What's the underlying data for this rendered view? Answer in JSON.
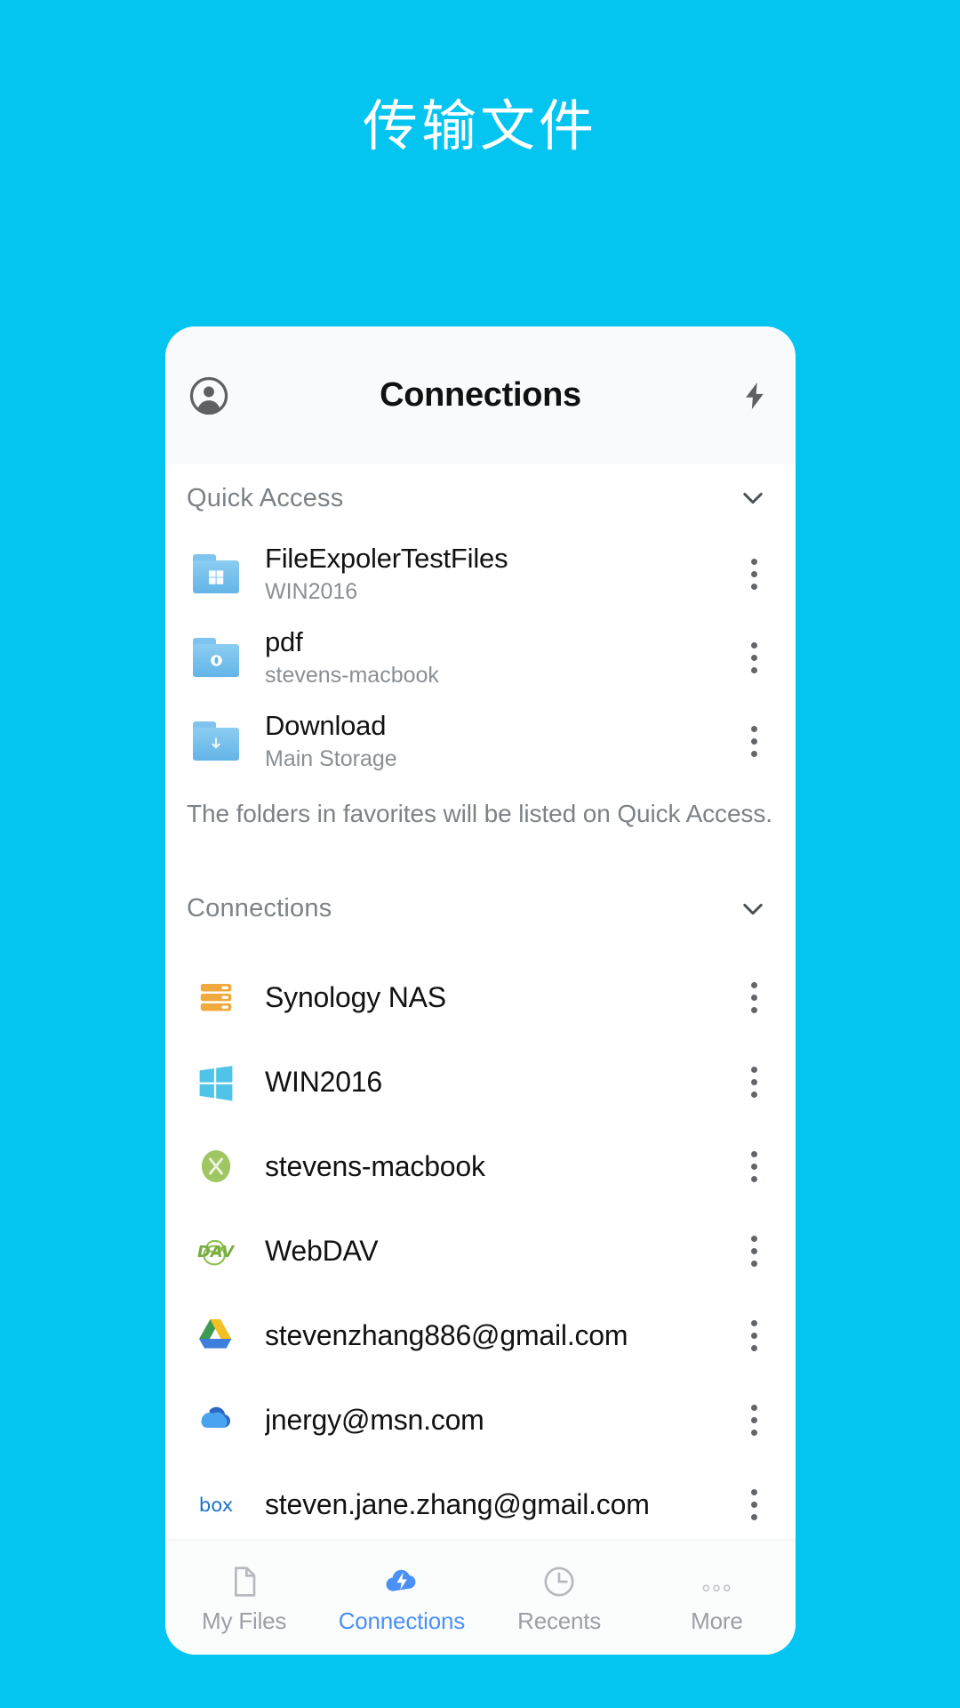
{
  "page": {
    "title": "传输文件",
    "background_color": "#04c5f0"
  },
  "app_header": {
    "title": "Connections",
    "avatar_icon": "account-circle-icon",
    "flash_icon": "lightning-bolt-icon"
  },
  "quick_access": {
    "label": "Quick Access",
    "collapse_icon": "chevron-down-icon",
    "hint": "The folders in favorites will be listed on Quick Access.",
    "items": [
      {
        "title": "FileExpolerTestFiles",
        "subtitle": "WIN2016",
        "icon": "folder-windows-icon",
        "menu_icon": "kebab-menu-icon"
      },
      {
        "title": "pdf",
        "subtitle": "stevens-macbook",
        "icon": "folder-mac-icon",
        "menu_icon": "kebab-menu-icon"
      },
      {
        "title": "Download",
        "subtitle": "Main Storage",
        "icon": "folder-download-icon",
        "menu_icon": "kebab-menu-icon"
      }
    ]
  },
  "connections": {
    "label": "Connections",
    "collapse_icon": "chevron-down-icon",
    "items": [
      {
        "title": "Synology NAS",
        "icon": "synology-nas-icon",
        "menu_icon": "kebab-menu-icon"
      },
      {
        "title": "WIN2016",
        "icon": "windows-icon",
        "menu_icon": "kebab-menu-icon"
      },
      {
        "title": "stevens-macbook",
        "icon": "mac-finder-icon",
        "menu_icon": "kebab-menu-icon"
      },
      {
        "title": "WebDAV",
        "icon": "webdav-icon",
        "menu_icon": "kebab-menu-icon"
      },
      {
        "title": "stevenzhang886@gmail.com",
        "icon": "google-drive-icon",
        "menu_icon": "kebab-menu-icon"
      },
      {
        "title": "jnergy@msn.com",
        "icon": "onedrive-icon",
        "menu_icon": "kebab-menu-icon"
      },
      {
        "title": "steven.jane.zhang@gmail.com",
        "icon": "box-icon",
        "menu_icon": "kebab-menu-icon"
      }
    ]
  },
  "bottom_nav": {
    "active_color": "#4a90f7",
    "items": [
      {
        "label": "My Files",
        "icon": "document-icon",
        "active": false
      },
      {
        "label": "Connections",
        "icon": "cloud-lightning-icon",
        "active": true
      },
      {
        "label": "Recents",
        "icon": "clock-icon",
        "active": false
      },
      {
        "label": "More",
        "icon": "more-dots-icon",
        "active": false
      }
    ]
  }
}
